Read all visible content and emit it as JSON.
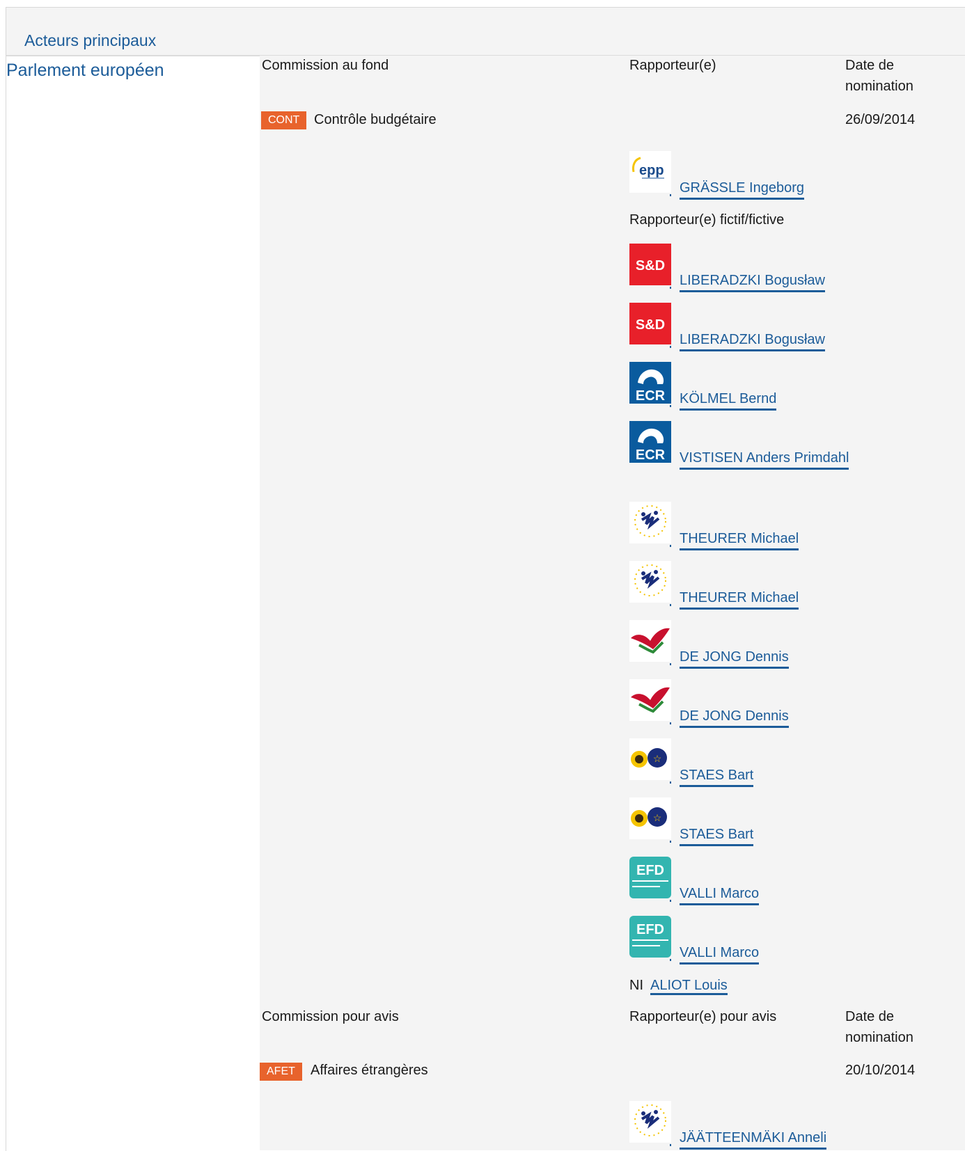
{
  "section_title": "Acteurs principaux",
  "institution": "Parlement européen",
  "lead": {
    "col_committee": "Commission au fond",
    "col_rapporteur": "Rapporteur(e)",
    "col_date_1": "Date de",
    "col_date_2": "nomination",
    "committee_code": "CONT",
    "committee_name": "Contrôle budgétaire",
    "date": "26/09/2014",
    "rapporteur": {
      "group_icon": "epp-logo-icon",
      "name": "GRÄSSLE Ingeborg"
    },
    "shadow_label": "Rapporteur(e) fictif/fictive",
    "shadows": [
      {
        "group_icon": "sd-logo-icon",
        "name": "LIBERADZKI Bogusław"
      },
      {
        "group_icon": "sd-logo-icon",
        "name": "LIBERADZKI Bogusław"
      },
      {
        "group_icon": "ecr-logo-icon",
        "name": "KÖLMEL Bernd"
      },
      {
        "group_icon": "ecr-logo-icon",
        "name": "VISTISEN Anders Primdahl"
      },
      {
        "group_icon": "alde-logo-icon",
        "name": "THEURER Michael"
      },
      {
        "group_icon": "alde-logo-icon",
        "name": "THEURER Michael"
      },
      {
        "group_icon": "gue-ngl-logo-icon",
        "name": "DE JONG Dennis"
      },
      {
        "group_icon": "gue-ngl-logo-icon",
        "name": "DE JONG Dennis"
      },
      {
        "group_icon": "greens-efa-logo-icon",
        "name": "STAES Bart"
      },
      {
        "group_icon": "greens-efa-logo-icon",
        "name": "STAES Bart"
      },
      {
        "group_icon": "efdd-logo-icon",
        "name": "VALLI Marco"
      },
      {
        "group_icon": "efdd-logo-icon",
        "name": "VALLI Marco"
      }
    ],
    "ni_label": "NI",
    "ni_name": "ALIOT Louis"
  },
  "opinion": {
    "col_committee": "Commission pour avis",
    "col_rapporteur": "Rapporteur(e) pour avis",
    "col_date_1": "Date de",
    "col_date_2": "nomination",
    "committee_code": "AFET",
    "committee_name": "Affaires étrangères",
    "date": "20/10/2014",
    "rapporteur": {
      "group_icon": "alde-logo-icon",
      "name": "JÄÄTTEENMÄKI Anneli"
    }
  },
  "colors": {
    "link": "#1c5c99",
    "badge": "#e8632c",
    "panel": "#f4f4f4"
  }
}
